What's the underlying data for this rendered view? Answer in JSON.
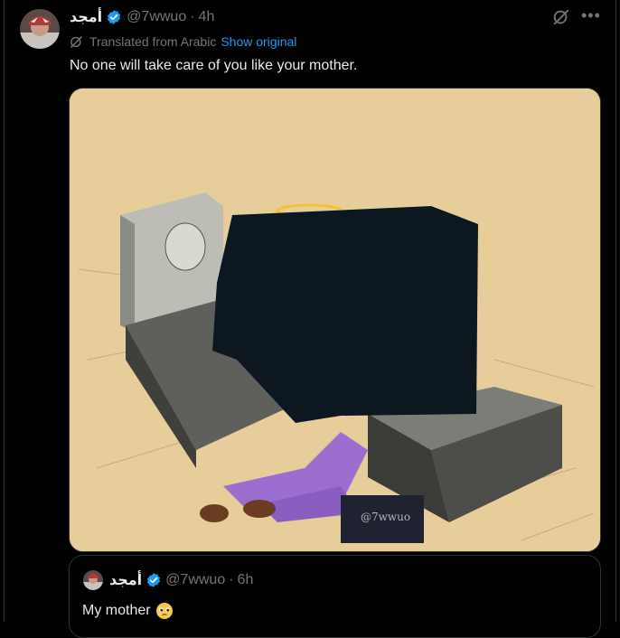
{
  "tweet": {
    "author_name": "أمجد",
    "handle": "@7wwuo",
    "separator": "·",
    "time": "4h",
    "translated_label": "Translated from Arabic",
    "show_original_label": "Show original",
    "text": "No one will take care of you like your mother.",
    "media_watermark": "@7wwuo"
  },
  "quoted_tweet": {
    "author_name": "أمجد",
    "handle": "@7wwuo",
    "separator": "·",
    "time": "6h",
    "text": "My mother",
    "emoji": "pleading-face-emoji"
  },
  "icons": {
    "verified": "verified-badge-icon",
    "grok": "grok-icon",
    "more": "more-icon",
    "translate": "translate-icon"
  },
  "colors": {
    "background": "#000000",
    "text_primary": "#e7e9ea",
    "text_secondary": "#71767b",
    "link": "#1d9bf0",
    "border": "#2f3336",
    "verified": "#1d9bf0"
  }
}
